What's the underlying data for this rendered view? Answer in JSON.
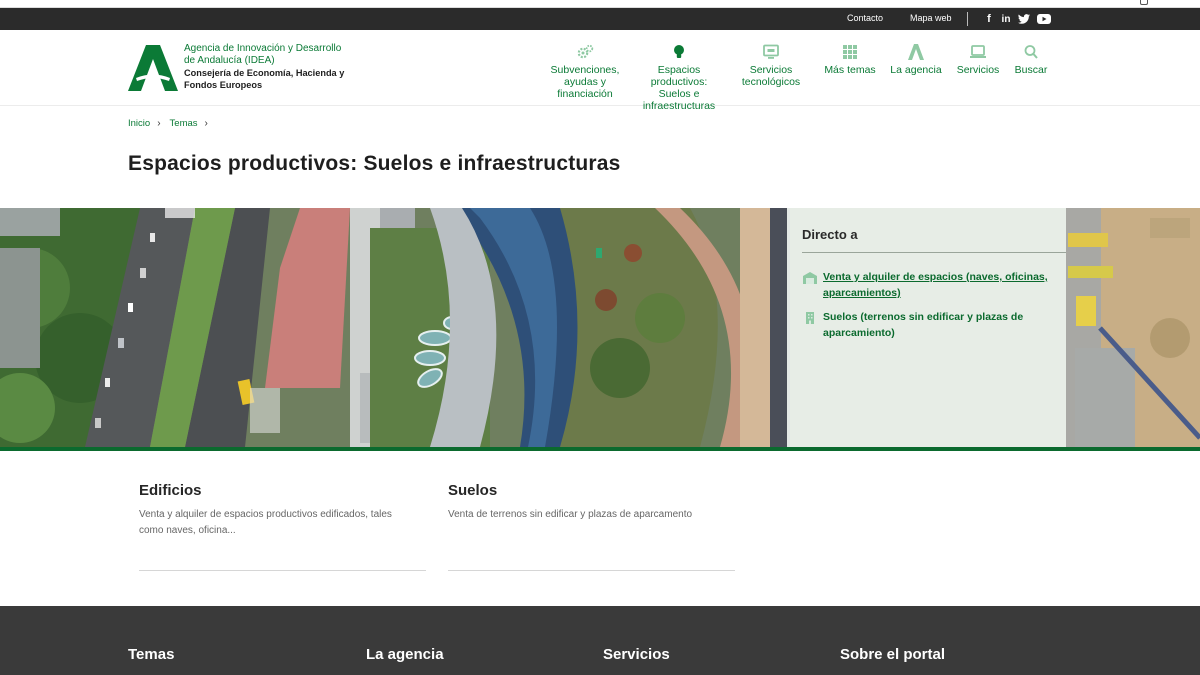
{
  "topbar": {
    "contact": "Contacto",
    "sitemap": "Mapa web",
    "social": [
      {
        "icon": "facebook-icon",
        "glyph": "f"
      },
      {
        "icon": "linkedin-icon",
        "glyph": "in"
      },
      {
        "icon": "twitter-icon",
        "glyph": "t"
      },
      {
        "icon": "youtube-icon",
        "glyph": "▶"
      }
    ]
  },
  "header": {
    "brand_line1": "Agencia de Innovación y Desarrollo de Andalucía (IDEA)",
    "brand_line2": "Consejería de Economía, Hacienda y Fondos Europeos",
    "accent": "#0b7a36",
    "nav": [
      {
        "label": "Subvenciones, ayudas y financiación",
        "icon": "gears-icon"
      },
      {
        "label": "Espacios productivos: Suelos e infraestructuras",
        "icon": "lightbulb-icon"
      },
      {
        "label": "Servicios tecnológicos",
        "icon": "monitor-icon"
      },
      {
        "label": "Más temas",
        "icon": "grid-icon"
      },
      {
        "label": "La agencia",
        "icon": "agency-logo-icon"
      },
      {
        "label": "Servicios",
        "icon": "laptop-icon"
      },
      {
        "label": "Buscar",
        "icon": "search-icon"
      }
    ]
  },
  "breadcrumb": {
    "items": [
      "Inicio",
      "Temas"
    ]
  },
  "page": {
    "title": "Espacios productivos: Suelos e infraestructuras"
  },
  "direct": {
    "title": "Directo a",
    "links": [
      {
        "label": "Venta y alquiler de espacios (naves, oficinas, aparcamientos)",
        "icon": "warehouse-icon"
      },
      {
        "label": "Suelos (terrenos sin edificar y plazas de aparcamiento)",
        "icon": "building-icon"
      }
    ]
  },
  "cards": [
    {
      "title": "Edificios",
      "desc": "Venta y alquiler de espacios productivos edificados, tales como naves, oficina..."
    },
    {
      "title": "Suelos",
      "desc": "Venta de terrenos sin edificar y plazas de aparcamento"
    }
  ],
  "footer": {
    "headings": [
      "Temas",
      "La agencia",
      "Servicios",
      "Sobre el portal"
    ]
  }
}
